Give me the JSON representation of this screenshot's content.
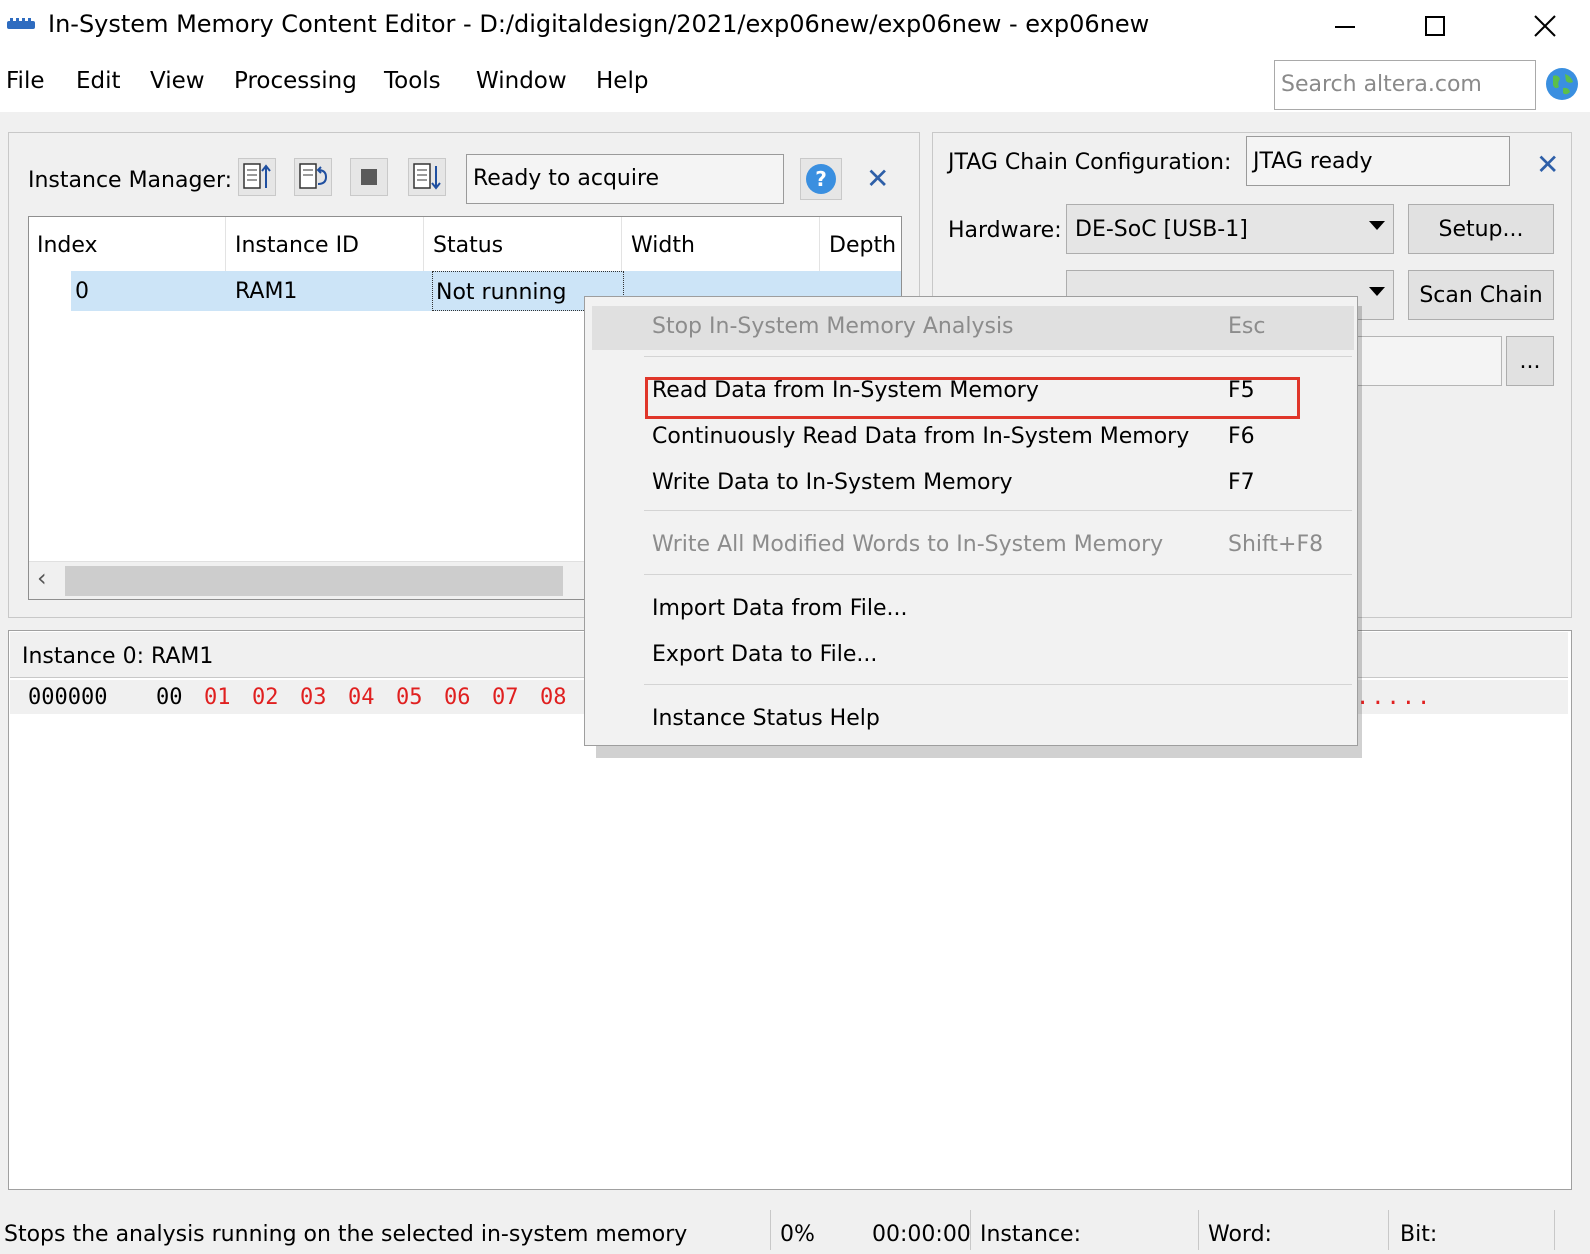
{
  "window": {
    "title": "In-System Memory Content Editor - D:/digitaldesign/2021/exp06new/exp06new - exp06new"
  },
  "menubar": {
    "items": [
      "File",
      "Edit",
      "View",
      "Processing",
      "Tools",
      "Window",
      "Help"
    ],
    "search_placeholder": "Search altera.com"
  },
  "instance_manager": {
    "label": "Instance Manager:",
    "status": "Ready to acquire",
    "columns": [
      "Index",
      "Instance ID",
      "Status",
      "Width",
      "Depth"
    ],
    "rows": [
      {
        "index": "0",
        "instance_id": "RAM1",
        "status": "Not running"
      }
    ]
  },
  "jtag": {
    "label": "JTAG Chain Configuration:",
    "status": "JTAG ready",
    "hardware_label": "Hardware:",
    "hardware_value": "DE-SoC [USB-1]",
    "setup_button": "Setup...",
    "scan_chain_button": "Scan Chain",
    "browse_button": "..."
  },
  "memory": {
    "title": "Instance 0: RAM1",
    "address": "000000",
    "first_word": "00",
    "words": [
      "01",
      "02",
      "03",
      "04",
      "05",
      "06",
      "07",
      "08"
    ],
    "ascii_dots": "....."
  },
  "context_menu": {
    "items": [
      {
        "label": "Stop In-System Memory Analysis",
        "shortcut": "Esc",
        "disabled": true
      },
      {
        "label": "Read Data from In-System Memory",
        "shortcut": "F5",
        "highlighted": true
      },
      {
        "label": "Continuously Read Data from In-System Memory",
        "shortcut": "F6"
      },
      {
        "label": "Write Data to In-System Memory",
        "shortcut": "F7"
      },
      {
        "label": "Write All Modified Words to In-System Memory",
        "shortcut": "Shift+F8",
        "disabled": true
      },
      {
        "label": "Import Data from File..."
      },
      {
        "label": "Export Data to File..."
      },
      {
        "label": "Instance Status Help"
      }
    ]
  },
  "statusbar": {
    "message": "Stops the analysis running on the selected in-system memory",
    "progress": "0%",
    "elapsed": "00:00:00",
    "instance_label": "Instance:",
    "word_label": "Word:",
    "bit_label": "Bit:"
  },
  "colors": {
    "accent_blue": "#2e5fa8",
    "highlight_red": "#e0362a",
    "memory_changed": "#e02020",
    "selection": "#cce4f7"
  }
}
